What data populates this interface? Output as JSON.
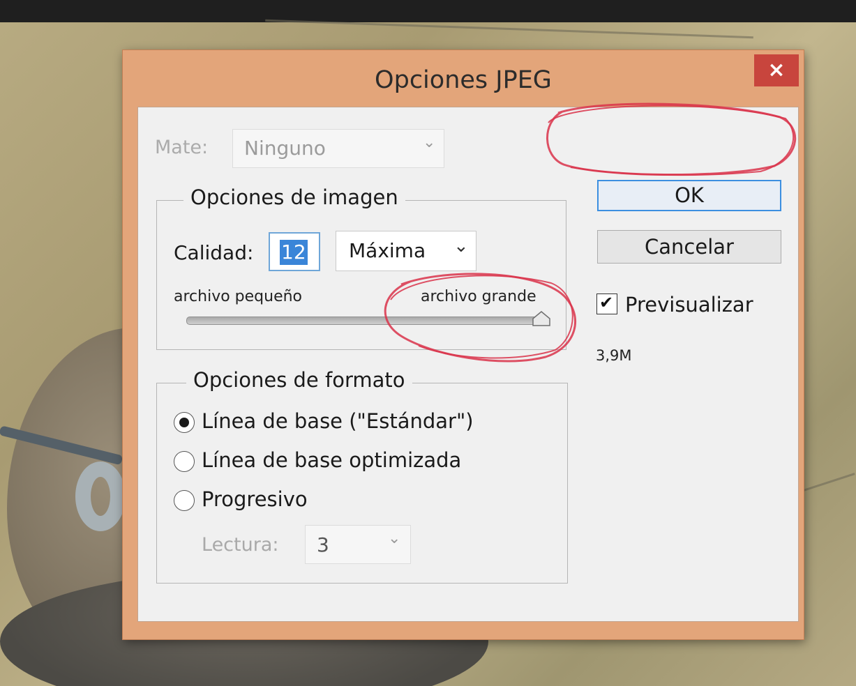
{
  "dialog": {
    "title": "Opciones JPEG",
    "close_symbol": "×",
    "titlebar_color": "#e3a57a",
    "close_button_color": "#c8453d"
  },
  "mate": {
    "label": "Mate:",
    "value": "Ninguno",
    "arrow": "⌄"
  },
  "image_options": {
    "group_title": "Opciones de imagen",
    "quality_label": "Calidad:",
    "quality_value": "12",
    "quality_preset": "Máxima",
    "preset_arrow": "⌄",
    "slider_min_label": "archivo pequeño",
    "slider_max_label": "archivo grande",
    "slider_level_fraction": 1.0
  },
  "format_options": {
    "group_title": "Opciones de formato",
    "radios": [
      {
        "label": "Línea de base (\"Estándar\")",
        "selected": true
      },
      {
        "label": "Línea de base optimizada",
        "selected": false
      },
      {
        "label": "Progresivo",
        "selected": false
      }
    ],
    "scans_label": "Lectura:",
    "scans_value": "3",
    "scans_arrow": "⌄"
  },
  "buttons": {
    "ok": "OK",
    "cancel": "Cancelar"
  },
  "preview": {
    "label": "Previsualizar",
    "checked": true,
    "checkmark": "✔"
  },
  "file_size": "3,9M",
  "annotation_color": "#d9334a",
  "selection_color": "#3a85d8"
}
